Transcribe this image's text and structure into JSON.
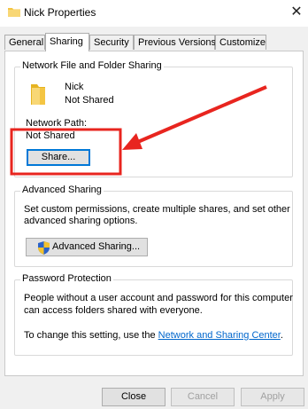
{
  "window": {
    "title": "Nick Properties",
    "close_glyph": "✕"
  },
  "tabs": [
    {
      "label": "General",
      "active": false
    },
    {
      "label": "Sharing",
      "active": true
    },
    {
      "label": "Security",
      "active": false
    },
    {
      "label": "Previous Versions",
      "active": false
    },
    {
      "label": "Customize",
      "active": false
    }
  ],
  "network_sharing": {
    "group_title": "Network File and Folder Sharing",
    "folder_name": "Nick",
    "share_status": "Not Shared",
    "path_label": "Network Path:",
    "path_value": "Not Shared",
    "share_button": "Share..."
  },
  "advanced_sharing": {
    "group_title": "Advanced Sharing",
    "description_line1": "Set custom permissions, create multiple shares, and set other",
    "description_line2": "advanced sharing options.",
    "button": "Advanced Sharing..."
  },
  "password_protection": {
    "group_title": "Password Protection",
    "description_line1": "People without a user account and password for this computer",
    "description_line2": "can access folders shared with everyone.",
    "change_prefix": "To change this setting, use the",
    "link_text": "Network and Sharing Center",
    "change_suffix": "."
  },
  "footer": {
    "close": "Close",
    "cancel": "Cancel",
    "apply": "Apply"
  },
  "colors": {
    "annotation": "#e8251f",
    "folder": "#f4c542",
    "link": "#0066cc",
    "focus": "#0078d7"
  },
  "icons": {
    "title": "folder-icon",
    "folder": "folder-icon",
    "shield": "shield-icon",
    "close": "close-icon"
  }
}
